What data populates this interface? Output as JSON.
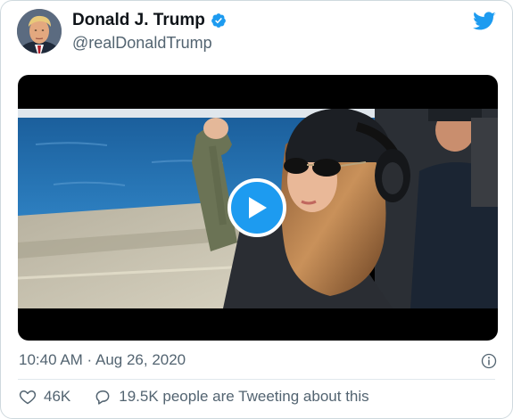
{
  "author": {
    "display_name": "Donald J. Trump",
    "handle": "@realDonaldTrump",
    "verified": true
  },
  "icons": {
    "avatar": "profile-photo",
    "verified": "verified-badge-icon",
    "brand": "twitter-bird-icon",
    "play": "play-icon",
    "info": "info-icon",
    "like": "heart-icon",
    "reply": "speech-bubble-icon"
  },
  "media": {
    "type": "video"
  },
  "meta": {
    "timestamp": "10:40 AM · Aug 26, 2020"
  },
  "engagement": {
    "likes": "46K",
    "conversation": "19.5K people are Tweeting about this"
  },
  "colors": {
    "brand_blue": "#1d9bf0",
    "text_primary": "#0f1419",
    "text_secondary": "#536471",
    "border": "#cfd9de"
  }
}
